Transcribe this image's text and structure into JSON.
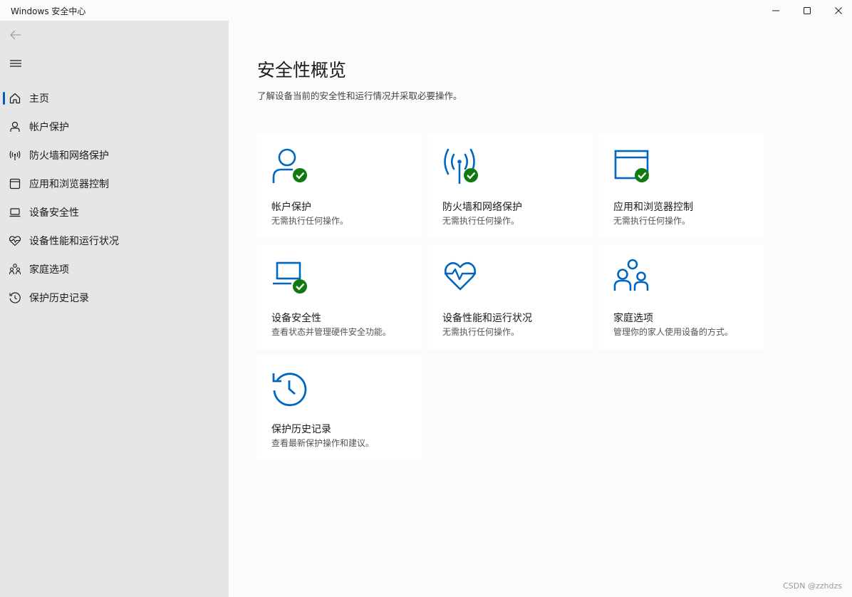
{
  "window": {
    "title": "Windows 安全中心"
  },
  "sidebar": {
    "items": [
      {
        "label": "主页",
        "icon": "home-icon",
        "active": true
      },
      {
        "label": "帐户保护",
        "icon": "person-icon"
      },
      {
        "label": "防火墙和网络保护",
        "icon": "antenna-icon"
      },
      {
        "label": "应用和浏览器控制",
        "icon": "browser-window-icon"
      },
      {
        "label": "设备安全性",
        "icon": "laptop-icon"
      },
      {
        "label": "设备性能和运行状况",
        "icon": "heart-pulse-icon"
      },
      {
        "label": "家庭选项",
        "icon": "family-icon"
      },
      {
        "label": "保护历史记录",
        "icon": "history-icon"
      }
    ]
  },
  "main": {
    "title": "安全性概览",
    "subtitle": "了解设备当前的安全性和运行情况并采取必要操作。",
    "cards": [
      {
        "title": "帐户保护",
        "desc": "无需执行任何操作。",
        "icon": "person-icon",
        "status": "ok"
      },
      {
        "title": "防火墙和网络保护",
        "desc": "无需执行任何操作。",
        "icon": "antenna-icon",
        "status": "ok"
      },
      {
        "title": "应用和浏览器控制",
        "desc": "无需执行任何操作。",
        "icon": "browser-window-icon",
        "status": "ok"
      },
      {
        "title": "设备安全性",
        "desc": "查看状态并管理硬件安全功能。",
        "icon": "laptop-icon",
        "status": "ok"
      },
      {
        "title": "设备性能和运行状况",
        "desc": "无需执行任何操作。",
        "icon": "heart-pulse-icon"
      },
      {
        "title": "家庭选项",
        "desc": "管理你的家人使用设备的方式。",
        "icon": "family-icon"
      },
      {
        "title": "保护历史记录",
        "desc": "查看最新保护操作和建议。",
        "icon": "history-icon"
      }
    ]
  },
  "watermark": "CSDN @zzhdzs",
  "colors": {
    "accent": "#0067c0",
    "ok": "#0f7b0f",
    "sidebar_bg": "#e6e6e6"
  }
}
